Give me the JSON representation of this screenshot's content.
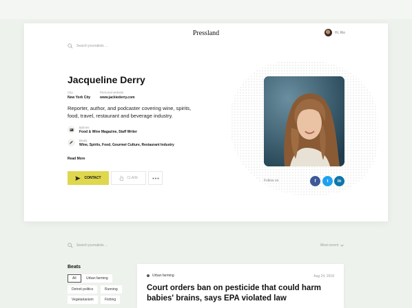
{
  "header": {
    "search_placeholder": "Search journalists ...",
    "brand": "Pressland",
    "user_name": "Hi, Rio"
  },
  "profile": {
    "name": "Jacqueline Derry",
    "city_label": "City",
    "city": "New York City",
    "website_label": "Personal website",
    "website": "www.jackiederry.com",
    "bio": "Reporter, author, and podcaster covering wine, spirits, food, travel, restaurant and beverage industry.",
    "bylines_label": "Bylines",
    "bylines": "Food & Wine Magazine, Staff Writer",
    "beats_label": "Beats",
    "beats": "Wine, Spirits, Food, Gourmet Culture, Restaurant Industry",
    "read_more": "Read More",
    "contact_label": "CONTACT",
    "claim_label": "CLAIM",
    "follow_label": "Follow on",
    "social": [
      {
        "name": "facebook",
        "glyph": "f",
        "color": "#3b5998"
      },
      {
        "name": "twitter",
        "glyph": "t",
        "color": "#1da1f2"
      },
      {
        "name": "linkedin",
        "glyph": "in",
        "color": "#0e76a8"
      }
    ]
  },
  "feed": {
    "search_placeholder": "Search journalists ...",
    "sort_label": "Most recent",
    "beats_heading": "Beats",
    "beat_filters": [
      "All",
      "Urban farming",
      "Detroit politics",
      "Running",
      "Vegetarianism",
      "Fishing"
    ],
    "active_filter": "All",
    "article": {
      "tag": "Urban farming",
      "date": "Aug 24, 2018",
      "headline": "Court orders ban on pesticide that could harm babies' brains, says EPA violated law"
    }
  },
  "colors": {
    "accent": "#dfd74e",
    "background": "#eef2ec",
    "card": "#ffffff"
  },
  "icons": [
    "search-icon",
    "avatar",
    "newspaper-icon",
    "quill-icon",
    "paper-plane-icon",
    "hand-pointer-icon",
    "more-dots-icon",
    "facebook-icon",
    "twitter-icon",
    "linkedin-icon",
    "chevron-down-icon"
  ]
}
